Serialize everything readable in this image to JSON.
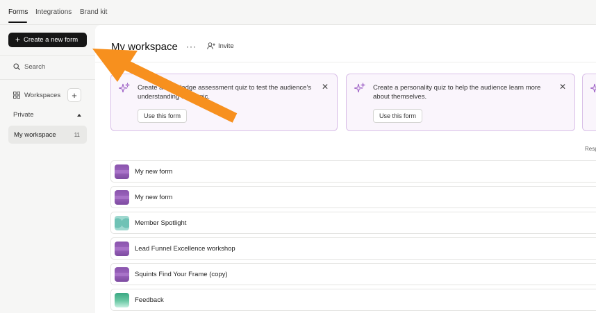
{
  "topnav": {
    "tabs": [
      {
        "label": "Forms",
        "active": true
      },
      {
        "label": "Integrations",
        "active": false
      },
      {
        "label": "Brand kit",
        "active": false
      }
    ]
  },
  "sidebar": {
    "create_label": "Create a new form",
    "search_label": "Search",
    "workspaces_label": "Workspaces",
    "private_label": "Private",
    "workspace_item": {
      "label": "My workspace",
      "count": "11"
    }
  },
  "main": {
    "title": "My workspace",
    "more_label": "···",
    "invite_label": "Invite",
    "templates": [
      {
        "description": "Create a knowledge assessment quiz to test the audience's understanding of a topic.",
        "button": "Use this form"
      },
      {
        "description": "Create a personality quiz to help the audience learn more about themselves.",
        "button": "Use this form"
      }
    ],
    "responses_header": "Resp",
    "forms": [
      {
        "name": "My new form",
        "thumb": "purple"
      },
      {
        "name": "My new form",
        "thumb": "purple"
      },
      {
        "name": "Member Spotlight",
        "thumb": "teal"
      },
      {
        "name": "Lead Funnel Excellence workshop",
        "thumb": "purple"
      },
      {
        "name": "Squints Find Your Frame (copy)",
        "thumb": "purple"
      },
      {
        "name": "Feedback",
        "thumb": "green"
      }
    ]
  },
  "colors": {
    "accent_dark": "#161616",
    "template_border": "#d9bfe8",
    "template_bg": "#faf5fc",
    "annotation_arrow": "#f7901e"
  },
  "icons": [
    "search-icon",
    "grid-icon",
    "plus-icon",
    "user-plus-icon",
    "sparkle-icon",
    "close-icon",
    "caret-up-icon"
  ]
}
